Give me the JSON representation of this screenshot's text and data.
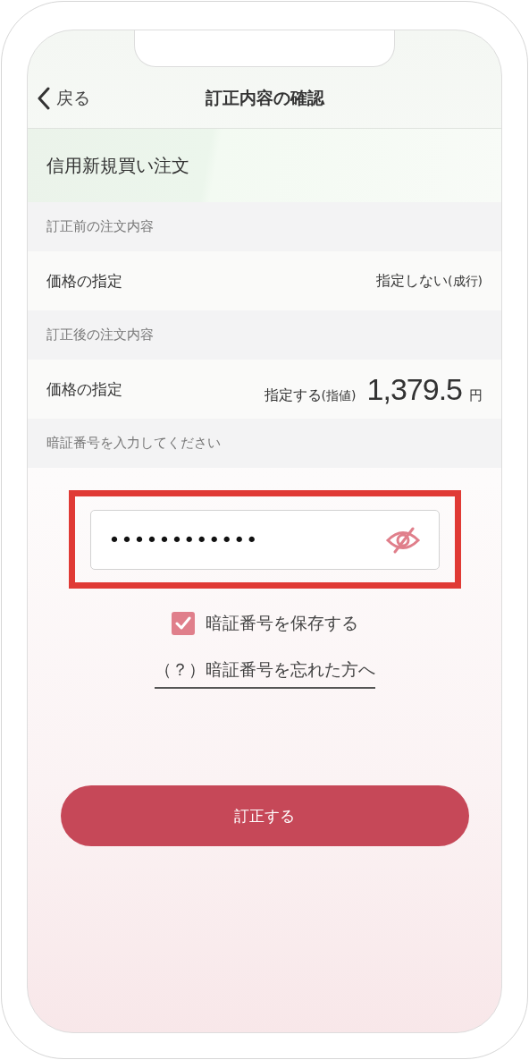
{
  "header": {
    "back_label": "戻る",
    "title": "訂正内容の確認"
  },
  "order_type": "信用新規買い注文",
  "sections": [
    {
      "heading": "訂正前の注文内容",
      "rows": [
        {
          "label": "価格の指定",
          "value": "指定しない",
          "value_note": "(成行)"
        }
      ]
    },
    {
      "heading": "訂正後の注文内容",
      "rows": [
        {
          "label": "価格の指定",
          "value": "指定する",
          "value_note": "(指値)",
          "price": "1,379.5",
          "unit": "円"
        }
      ]
    }
  ],
  "pin": {
    "heading": "暗証番号を入力してください",
    "value": "••••••••••••",
    "masked": true,
    "highlighted": true
  },
  "save_pin": {
    "label": "暗証番号を保存する",
    "checked": true
  },
  "forgot_link": "（？）暗証番号を忘れた方へ",
  "submit_button": "訂正する"
}
